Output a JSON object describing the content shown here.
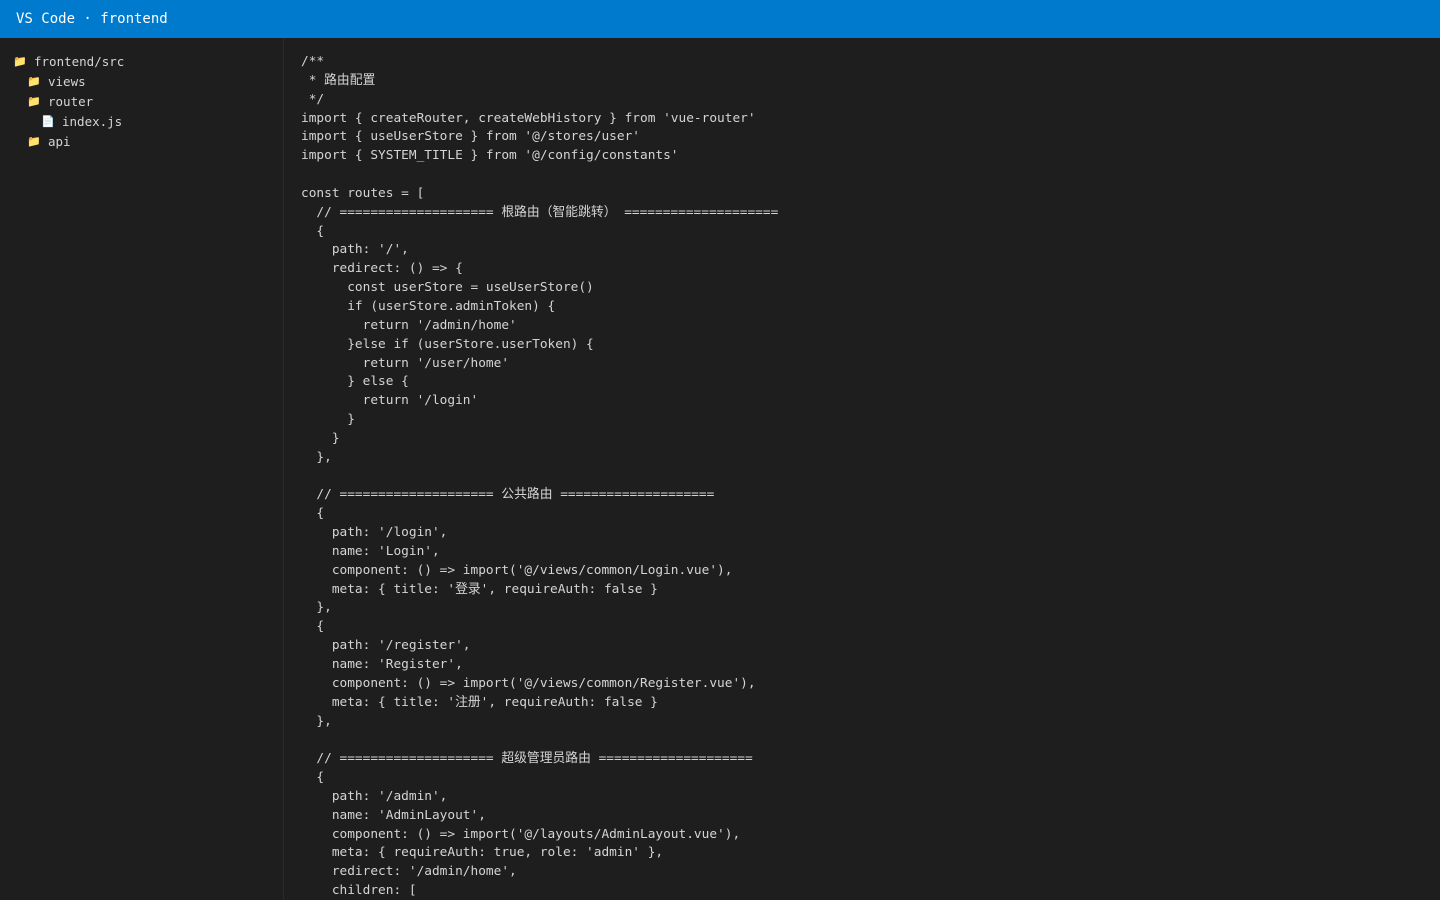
{
  "window": {
    "title": "VS Code · frontend"
  },
  "explorer": {
    "items": [
      {
        "label": "frontend/src",
        "icon": "folder-icon",
        "depth": 0
      },
      {
        "label": "views",
        "icon": "folder-icon",
        "depth": 1
      },
      {
        "label": "router",
        "icon": "folder-icon",
        "depth": 1
      },
      {
        "label": "index.js",
        "icon": "file-icon",
        "depth": 2
      },
      {
        "label": "api",
        "icon": "folder-icon",
        "depth": 1
      }
    ]
  },
  "editor": {
    "lines": [
      "/**",
      " * 路由配置",
      " */",
      "import { createRouter, createWebHistory } from 'vue-router'",
      "import { useUserStore } from '@/stores/user'",
      "import { SYSTEM_TITLE } from '@/config/constants'",
      "",
      "const routes = [",
      "  // ==================== 根路由（智能跳转） ====================",
      "  {",
      "    path: '/',",
      "    redirect: () => {",
      "      const userStore = useUserStore()",
      "      if (userStore.adminToken) {",
      "        return '/admin/home'",
      "      }else if (userStore.userToken) {",
      "        return '/user/home'",
      "      } else {",
      "        return '/login'",
      "      }",
      "    }",
      "  },",
      "",
      "  // ==================== 公共路由 ====================",
      "  {",
      "    path: '/login',",
      "    name: 'Login',",
      "    component: () => import('@/views/common/Login.vue'),",
      "    meta: { title: '登录', requireAuth: false }",
      "  },",
      "  {",
      "    path: '/register',",
      "    name: 'Register',",
      "    component: () => import('@/views/common/Register.vue'),",
      "    meta: { title: '注册', requireAuth: false }",
      "  },",
      "",
      "  // ==================== 超级管理员路由 ====================",
      "  {",
      "    path: '/admin',",
      "    name: 'AdminLayout',",
      "    component: () => import('@/layouts/AdminLayout.vue'),",
      "    meta: { requireAuth: true, role: 'admin' },",
      "    redirect: '/admin/home',",
      "    children: ["
    ]
  }
}
